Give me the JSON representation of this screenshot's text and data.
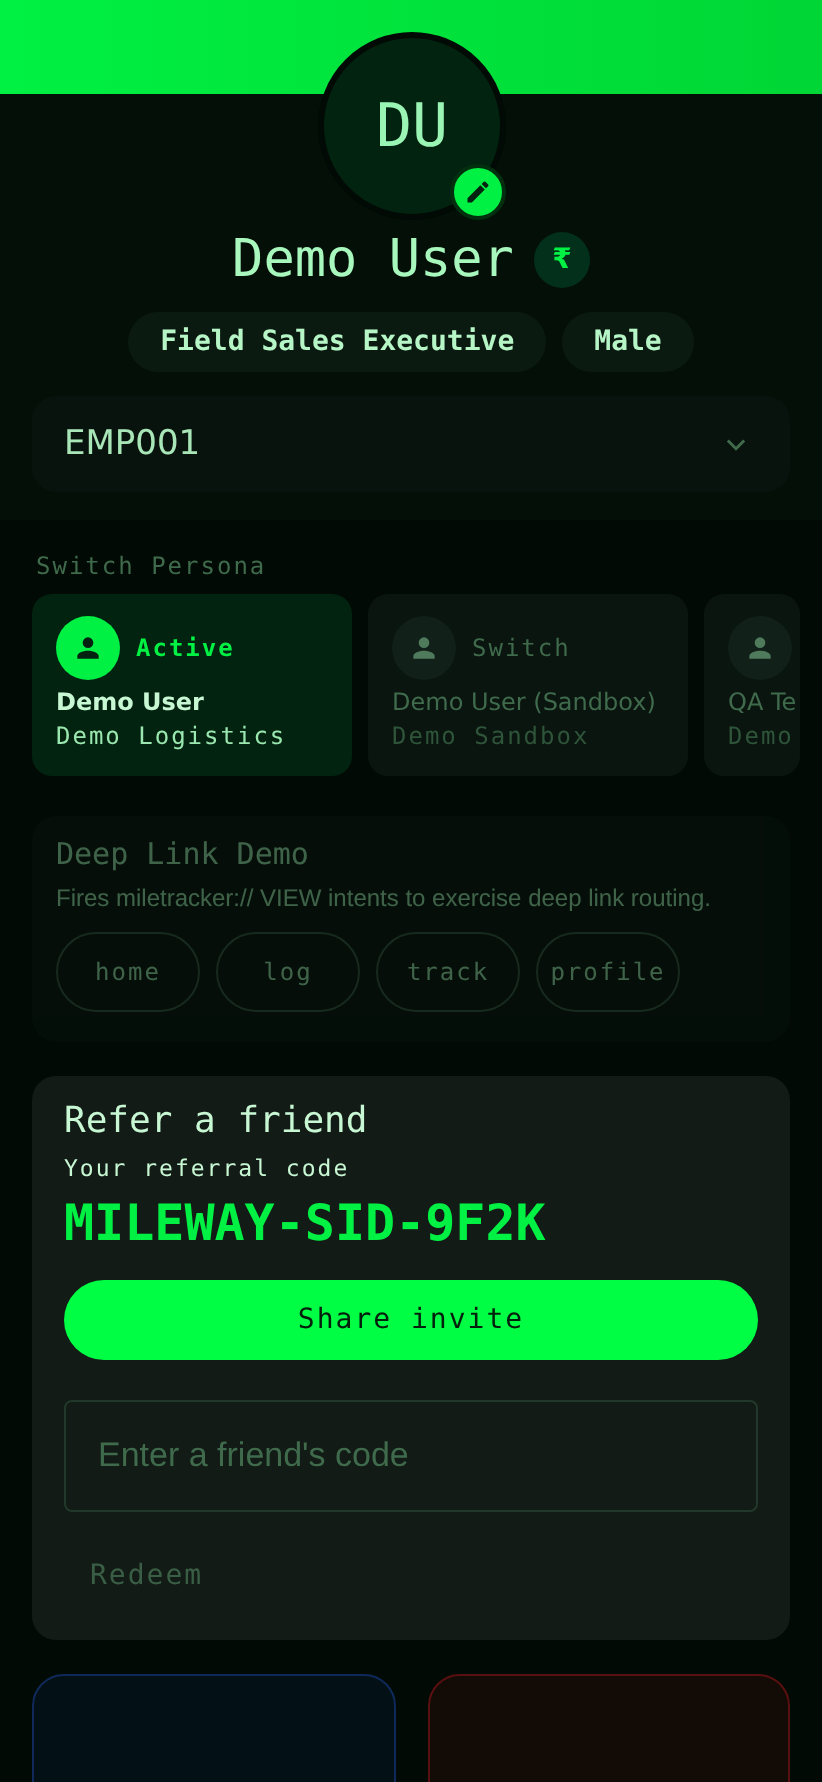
{
  "profile": {
    "initials": "DU",
    "name": "Demo User",
    "currency_badge": "₹",
    "chips": [
      "Field Sales Executive",
      "Male"
    ],
    "employee_select": {
      "value": "EMP001"
    }
  },
  "personas": {
    "title": "Switch Persona",
    "items": [
      {
        "status": "Active",
        "name": "Demo User",
        "org": "Demo Logistics",
        "selected": true
      },
      {
        "status": "Switch",
        "name": "Demo User (Sandbox)",
        "org": "Demo Sandbox",
        "selected": false
      },
      {
        "name": "QA Te",
        "org": "Demo",
        "selected": false
      }
    ]
  },
  "deep_link": {
    "title": "Deep Link Demo",
    "description": "Fires miletracker:// VIEW intents to exercise deep link routing.",
    "disabled": true,
    "links": [
      "home",
      "log",
      "track",
      "profile"
    ]
  },
  "referral": {
    "title": "Refer a friend",
    "code_label": "Your referral code",
    "code": "MILEWAY-SID-9F2K",
    "share_button": "Share invite",
    "input": {
      "placeholder": "Enter a friend's code"
    },
    "redeem_button": {
      "label": "Redeem",
      "disabled": true
    }
  },
  "bottom_cards": [
    {
      "color": "#0f2a5a"
    },
    {
      "color": "#5a1010"
    }
  ]
}
